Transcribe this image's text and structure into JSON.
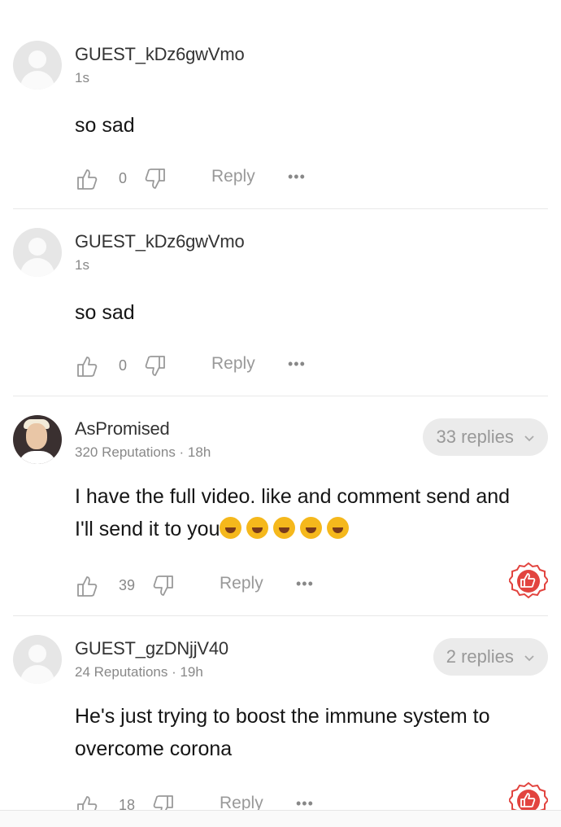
{
  "comments": [
    {
      "username": "GUEST_kDz6gwVmo",
      "meta": "1s",
      "text": "so sad",
      "likes": "0",
      "reply_label": "Reply",
      "more_label": "•••",
      "avatar": "default-avatar"
    },
    {
      "username": "GUEST_kDz6gwVmo",
      "meta": "1s",
      "text": "so sad",
      "likes": "0",
      "reply_label": "Reply",
      "more_label": "•••",
      "avatar": "default-avatar"
    },
    {
      "username": "AsPromised",
      "meta": "320 Reputations · 18h",
      "text_line1": "I have the full video. like and comment send and",
      "text_line2": "I'll send it to you",
      "emoji_count": "5",
      "emoji_icon": "rolling-on-floor-laughing-emoji",
      "likes": "39",
      "reply_label": "Reply",
      "more_label": "•••",
      "replies": "33 replies",
      "avatar": "user-photo-avatar",
      "badge_icon": "thumbs-up-badge-icon"
    },
    {
      "username": "GUEST_gzDNjjV40",
      "meta": "24 Reputations · 19h",
      "text_line1": "He's just trying to boost the immune system to",
      "text_line2": "overcome corona",
      "likes": "18",
      "reply_label": "Reply",
      "more_label": "•••",
      "replies": "2 replies",
      "avatar": "default-avatar",
      "badge_icon": "thumbs-up-badge-icon"
    }
  ],
  "colors": {
    "badge_red": "#e2443f",
    "pill_bg": "#ebebeb",
    "muted_text": "#888888"
  }
}
